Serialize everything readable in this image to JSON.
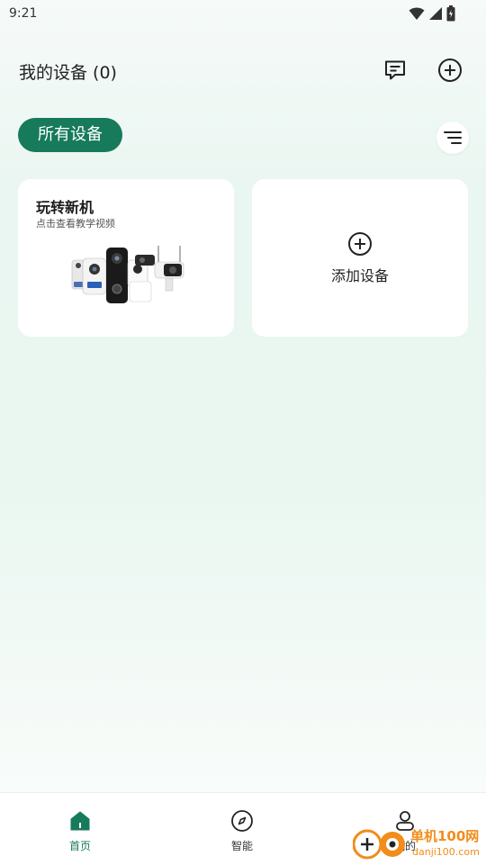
{
  "status_bar": {
    "time": "9:21"
  },
  "header": {
    "title": "我的设备 (0)"
  },
  "filter": {
    "all_label": "所有设备"
  },
  "guide_card": {
    "title": "玩转新机",
    "subtitle": "点击查看教学视频"
  },
  "add_card": {
    "label": "添加设备"
  },
  "bottom_nav": {
    "items": [
      {
        "label": "首页",
        "icon": "home-icon",
        "active": true
      },
      {
        "label": "智能",
        "icon": "compass-icon",
        "active": false
      },
      {
        "label": "我的",
        "icon": "profile-icon",
        "active": false
      }
    ]
  },
  "watermark": {
    "text": "单机100网",
    "url_text": "danji100.com"
  },
  "colors": {
    "accent": "#167a5b",
    "card_bg": "#ffffff",
    "watermark_orange": "#f28c1a"
  }
}
